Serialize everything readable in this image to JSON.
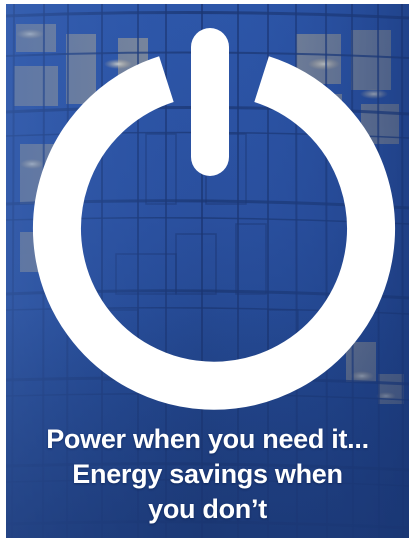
{
  "poster": {
    "tagline": {
      "line1": "Power when you need it...",
      "line2": "Energy savings when",
      "line3": "you don’t"
    },
    "icon": "power-icon",
    "background": "office-building-glass-facade",
    "colors": {
      "sky_blue": "#2d56a8",
      "deep_blue": "#1e3c7a",
      "window_glow": "#f3e3b8",
      "icon_white": "#ffffff"
    }
  }
}
